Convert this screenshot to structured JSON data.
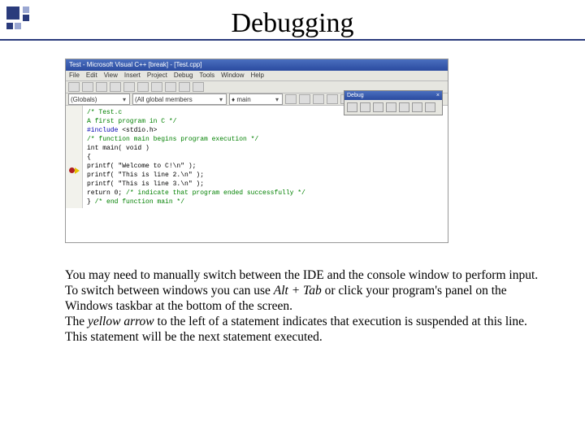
{
  "slide": {
    "title": "Debugging",
    "para1_a": "You may need to manually switch between the IDE and the console window to perform input. To switch between windows you can use ",
    "para1_alttab": "Alt + Tab",
    "para1_b": " or click your program's panel on the Windows taskbar at the bottom of the screen.",
    "para2_a": "The ",
    "para2_yellow": "yellow arrow",
    "para2_b": " to the left of a statement indicates that execution is suspended at this line. This statement will be the next statement executed."
  },
  "ide": {
    "titlebar": "Test - Microsoft Visual C++ [break] - [Test.cpp]",
    "close": "×",
    "menu": [
      "File",
      "Edit",
      "View",
      "Insert",
      "Project",
      "Debug",
      "Tools",
      "Window",
      "Help"
    ],
    "combo_globals": "(Globals)",
    "combo_members": "(All global members",
    "combo_main": "main",
    "code": {
      "l1": "/* Test.c",
      "l2": "   A first program in C */",
      "l3a": "#include ",
      "l3b": "<stdio.h>",
      "l4": "",
      "l5": "/* function main begins program execution */",
      "l6": "int main( void )",
      "l7": "{",
      "l8": "   printf( \"Welcome to C!\\n\" );",
      "l9": "   printf( \"This is line 2.\\n\" );",
      "l10": "   printf( \"This is line 3.\\n\" );",
      "l11": "",
      "l12a": "   return 0; ",
      "l12b": "/* indicate that program ended successfully */",
      "l13": "",
      "l14": "} ",
      "l14b": "/* end function main */"
    },
    "debug_panel": {
      "title": "Debug",
      "close": "×"
    }
  }
}
